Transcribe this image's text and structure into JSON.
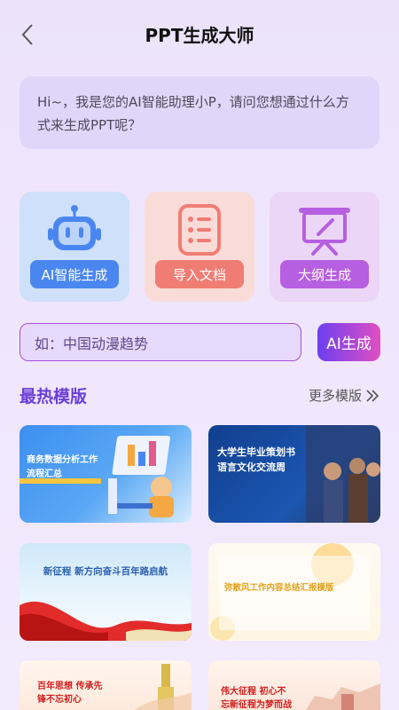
{
  "header": {
    "title": "PPT生成大师"
  },
  "assistant": {
    "message": "Hi~，我是您的AI智能助理小P，请问您想通过什么方式来生成PPT呢？"
  },
  "modes": [
    {
      "label": "AI智能生成",
      "icon": "robot-icon"
    },
    {
      "label": "导入文档",
      "icon": "document-list-icon"
    },
    {
      "label": "大纲生成",
      "icon": "presentation-board-icon"
    }
  ],
  "search": {
    "placeholder": "如：中国动漫趋势",
    "button_label": "AI生成"
  },
  "section": {
    "title": "最热模版",
    "more_label": "更多模版"
  },
  "templates": [
    {
      "title_line1": "商务数据分析工作",
      "title_line2": "流程汇总"
    },
    {
      "title_line1": "大学生毕业策划书",
      "title_line2": "语言文化交流周"
    },
    {
      "title_line1": "新征程 新方向奋斗百年路启航"
    },
    {
      "title_line1": "弥散风工作内容总结汇报模版"
    },
    {
      "title_line1": "百年思想 传承先",
      "title_line2": "锋不忘初心"
    },
    {
      "title_line1": "伟大征程 初心不",
      "title_line2": "忘新征程为梦而战"
    }
  ],
  "colors": {
    "accent": "#6b3fd8",
    "button_gradient": [
      "#6d3ff0",
      "#e14fc2"
    ]
  }
}
